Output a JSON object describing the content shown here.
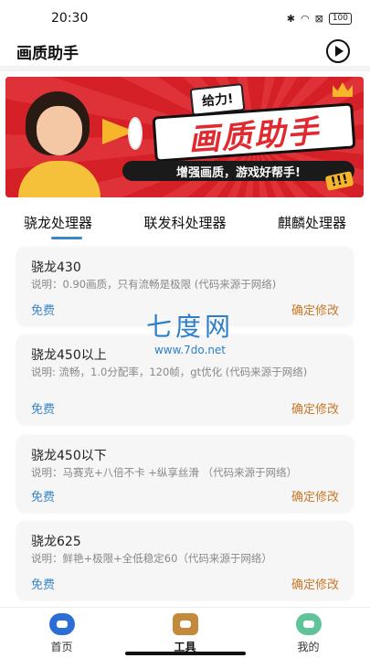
{
  "status_bar": {
    "time": "20:30",
    "battery": "100"
  },
  "app_bar": {
    "title": "画质助手"
  },
  "banner": {
    "bubble": "给力!",
    "title": "画质助手",
    "subtitle": "增强画质，游戏好帮手!",
    "exclaim": "!!!"
  },
  "tabs": [
    {
      "label": "骁龙处理器"
    },
    {
      "label": "联发科处理器"
    },
    {
      "label": "麒麟处理器"
    }
  ],
  "cards": [
    {
      "title": "骁龙430",
      "desc": "说明：0.90画质，只有流畅是极限 (代码来源于网络)",
      "free": "免费",
      "action": "确定修改"
    },
    {
      "title": "骁龙450以上",
      "desc": "说明: 流畅，1.0分配率，120帧，gt优化 (代码来源于网络)",
      "free": "免费",
      "action": "确定修改"
    },
    {
      "title": "骁龙450以下",
      "desc": "说明：马赛克+八倍不卡 +纵享丝滑 （代码来源于网络）",
      "free": "免费",
      "action": "确定修改"
    },
    {
      "title": "骁龙625",
      "desc": "说明：鲜艳+极限+全低稳定60（代码来源于网络）",
      "free": "免费",
      "action": "确定修改"
    }
  ],
  "watermark": {
    "main": "七度网",
    "sub": "www.7do.net"
  },
  "bottom_nav": [
    {
      "label": "首页",
      "icon": "gamepad-icon"
    },
    {
      "label": "工具",
      "icon": "toolbox-icon"
    },
    {
      "label": "我的",
      "icon": "user-icon"
    }
  ],
  "colors": {
    "accent_blue": "#3a86c8",
    "action_orange": "#c77828",
    "banner_red": "#d8232a"
  }
}
